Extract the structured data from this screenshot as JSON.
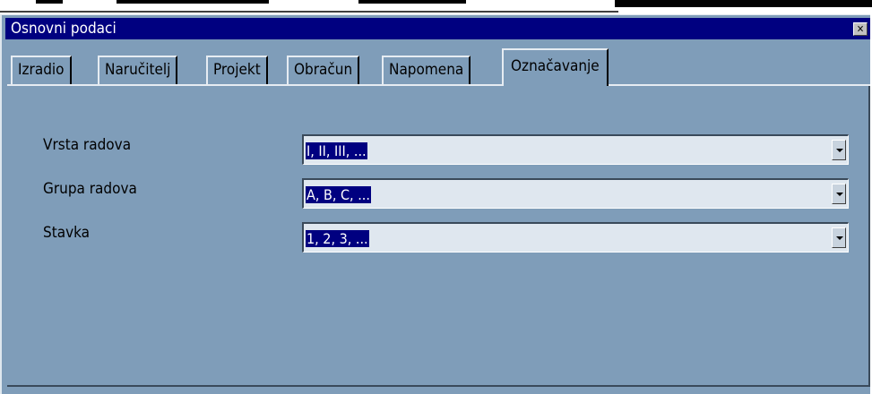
{
  "window": {
    "title": "Osnovni podaci",
    "close_glyph": "✕"
  },
  "tabs": [
    {
      "label": "Izradio"
    },
    {
      "label": "Naručitelj"
    },
    {
      "label": "Projekt"
    },
    {
      "label": "Obračun"
    },
    {
      "label": "Napomena"
    },
    {
      "label": "Označavanje",
      "active": true
    }
  ],
  "fields": [
    {
      "label": "Vrsta radova",
      "value": "I, II, III, ..."
    },
    {
      "label": "Grupa radova",
      "value": "A, B, C, ..."
    },
    {
      "label": "Stavka",
      "value": "1, 2, 3, ..."
    }
  ],
  "icons": {
    "close": "close-icon",
    "dropdown": "chevron-down-icon"
  },
  "colors": {
    "titlebar": "#000080",
    "panel": "#7f9db9",
    "field": "#dfe7ef",
    "selection": "#000080"
  }
}
